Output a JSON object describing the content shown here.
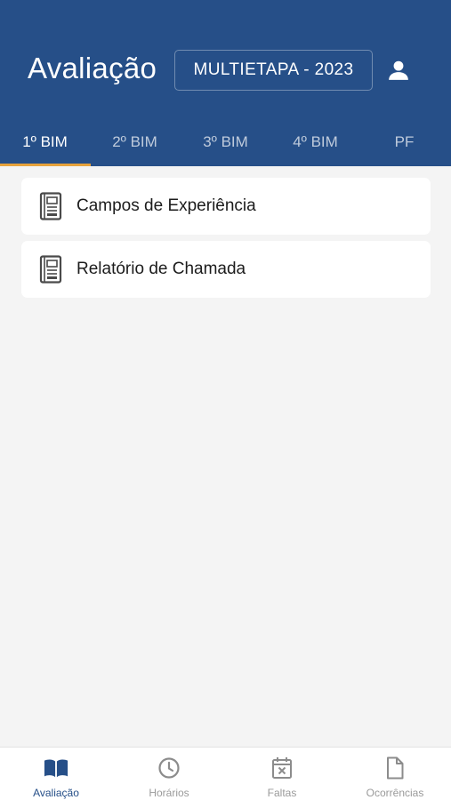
{
  "header": {
    "title": "Avaliação",
    "stage_button": "MULTIETAPA - 2023",
    "user_icon": "user-icon"
  },
  "tabs": [
    {
      "label": "1º BIM",
      "active": true
    },
    {
      "label": "2º BIM",
      "active": false
    },
    {
      "label": "3º BIM",
      "active": false
    },
    {
      "label": "4º BIM",
      "active": false
    },
    {
      "label": "PF",
      "active": false
    }
  ],
  "items": [
    {
      "label": "Campos de Experiência",
      "icon": "notebook-icon"
    },
    {
      "label": "Relatório de Chamada",
      "icon": "notebook-icon"
    }
  ],
  "bottom_nav": [
    {
      "label": "Avaliação",
      "icon": "book-open-icon",
      "active": true
    },
    {
      "label": "Horários",
      "icon": "clock-icon",
      "active": false
    },
    {
      "label": "Faltas",
      "icon": "calendar-x-icon",
      "active": false
    },
    {
      "label": "Ocorrências",
      "icon": "document-icon",
      "active": false
    }
  ],
  "colors": {
    "header_bg": "#264f88",
    "tab_indicator": "#e6a23c",
    "active_nav": "#264f88",
    "inactive_nav": "#9a9a9a"
  }
}
